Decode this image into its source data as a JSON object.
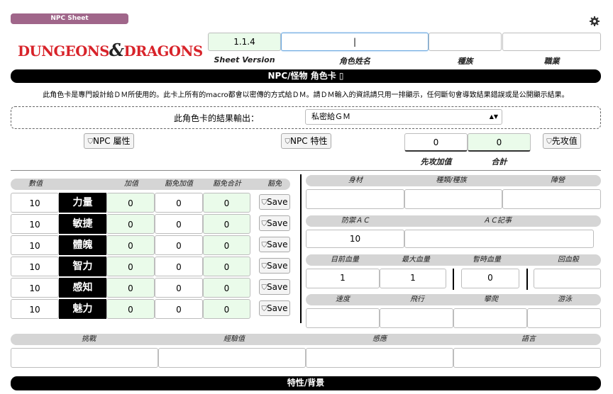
{
  "header": {
    "sheet_tab": "NPC Sheet",
    "logo_text_left": "DUNGEONS",
    "logo_amp": "&",
    "logo_text_right": "DRAGONS",
    "sheet_version_value": "1.1.4",
    "sheet_version_label": "Sheet Version",
    "name_label": "角色姓名",
    "race_label": "種族",
    "class_label": "職業",
    "name_value": "|"
  },
  "title_bar": "NPC/怪物 角色卡",
  "note": "此角色卡是專門設計給ＤＭ所使用的。此卡上所有的macro都會以密傳的方式給ＤＭ。請ＤＭ輸入的資訊請只用一排顯示，任何斷句會導致結果錯誤或是公開顯示結果。",
  "output": {
    "label": "此角色卡的結果輸出：",
    "selected": "私密給ＧＭ"
  },
  "buttons": {
    "npc_attr": "NPC 屬性",
    "npc_traits": "NPC 特性",
    "initiative": "先攻值"
  },
  "initiative": {
    "bonus_value": "0",
    "total_value": "0",
    "bonus_label": "先攻加值",
    "total_label": "合計"
  },
  "attr_headers": {
    "score": "數值",
    "mod": "加值",
    "save_bonus": "豁免加值",
    "save_total": "豁免合計",
    "save": "豁免"
  },
  "attributes": [
    {
      "score": "10",
      "name": "力量",
      "mod": "0",
      "save_bonus": "0",
      "save_total": "0",
      "save_btn": "Save"
    },
    {
      "score": "10",
      "name": "敏捷",
      "mod": "0",
      "save_bonus": "0",
      "save_total": "0",
      "save_btn": "Save"
    },
    {
      "score": "10",
      "name": "體魄",
      "mod": "0",
      "save_bonus": "0",
      "save_total": "0",
      "save_btn": "Save"
    },
    {
      "score": "10",
      "name": "智力",
      "mod": "0",
      "save_bonus": "0",
      "save_total": "0",
      "save_btn": "Save"
    },
    {
      "score": "10",
      "name": "感知",
      "mod": "0",
      "save_bonus": "0",
      "save_total": "0",
      "save_btn": "Save"
    },
    {
      "score": "10",
      "name": "魅力",
      "mod": "0",
      "save_bonus": "0",
      "save_total": "0",
      "save_btn": "Save"
    }
  ],
  "right": {
    "size_label": "身材",
    "type_label": "種類/種族",
    "alignment_label": "陣營",
    "ac_label": "防禦ＡＣ",
    "ac_notes_label": "ＡＣ記事",
    "ac_value": "10",
    "hp_label": "目前血量",
    "hp_max_label": "最大血量",
    "hp_temp_label": "暫時血量",
    "hit_dice_label": "回血骰",
    "hp_value": "1",
    "hp_max_value": "1",
    "hp_temp_value": "0",
    "speed_label": "速度",
    "fly_label": "飛行",
    "climb_label": "攀爬",
    "swim_label": "游泳"
  },
  "bottom": {
    "challenge_label": "挑戰",
    "xp_label": "經驗值",
    "senses_label": "感應",
    "languages_label": "語言"
  },
  "traits_bar": "特性/背景"
}
